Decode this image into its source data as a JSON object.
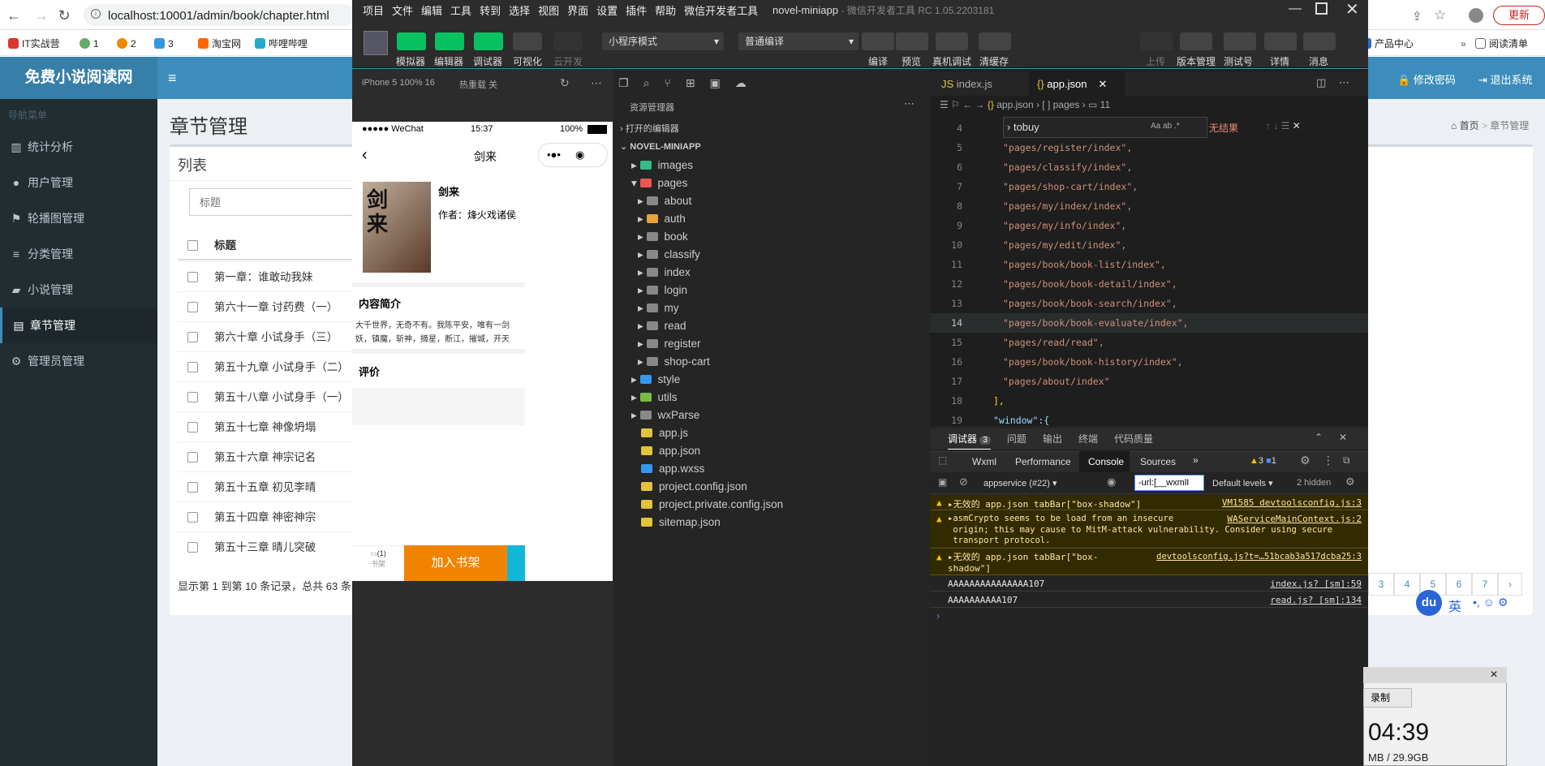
{
  "browser": {
    "url": "localhost:10001/admin/book/chapter.html",
    "update_label": "更新",
    "bookmarks": [
      "IT实战营",
      "1",
      "2",
      "3",
      "淘宝网",
      "哔哩哔哩"
    ],
    "bookmarks_right": [
      "产品中心",
      "阅读清单"
    ]
  },
  "admin": {
    "brand": "免费小说阅读网",
    "change_pwd": "修改密码",
    "logout": "退出系统",
    "nav_header": "导航菜单",
    "menu": [
      {
        "label": "统计分析"
      },
      {
        "label": "用户管理"
      },
      {
        "label": "轮播图管理"
      },
      {
        "label": "分类管理"
      },
      {
        "label": "小说管理"
      },
      {
        "label": "章节管理"
      },
      {
        "label": "管理员管理"
      }
    ],
    "page_title": "章节管理",
    "crumb_home": "首页",
    "crumb_current": "章节管理",
    "box_title": "列表",
    "search_placeholder": "标题",
    "col_title": "标题",
    "rows": [
      "第一章：谁敢动我妹",
      "第六十一章 讨药费（一）",
      "第六十章 小试身手（三）",
      "第五十九章 小试身手（二）",
      "第五十八章 小试身手（一）",
      "第五十七章 神像坍塌",
      "第五十六章 神宗记名",
      "第五十五章 初见李晴",
      "第五十四章 神密神宗",
      "第五十三章 晴儿突破"
    ],
    "footer_text": "显示第 1 到第 10 条记录，总共 63 条",
    "pages": [
      "3",
      "4",
      "5",
      "6",
      "7",
      "›"
    ]
  },
  "devtools": {
    "menu": [
      "项目",
      "文件",
      "编辑",
      "工具",
      "转到",
      "选择",
      "视图",
      "界面",
      "设置",
      "插件",
      "帮助",
      "微信开发者工具"
    ],
    "title": "novel-miniapp",
    "title_suffix": "- 微信开发者工具 RC 1.05.2203181",
    "toolbar": {
      "simulator": "模拟器",
      "editor": "编辑器",
      "debugger": "调试器",
      "visual": "可视化",
      "cloud": "云开发",
      "mode": "小程序模式",
      "compile_mode": "普通编译",
      "compile": "编译",
      "preview": "预览",
      "real_debug": "真机调试",
      "clear_cache": "清缓存",
      "upload": "上传",
      "version": "版本管理",
      "test": "测试号",
      "details": "详情",
      "messages": "消息"
    },
    "device": "iPhone 5 100% 16",
    "hot_reload": "热重载 关",
    "phone": {
      "carrier": "●●●●● WeChat",
      "time": "15:37",
      "battery": "100%",
      "nav_title": "剑来",
      "book_title": "剑来",
      "author": "作者：烽火戏诸侯",
      "intro_h": "内容简介",
      "intro_1": "大千世界，无奇不有。我陈平安，唯有一剑",
      "intro_2": "妖，镇魔，斩神，摘星，断江，摧城，开天",
      "review_h": "评价",
      "shelf": "书架",
      "shelf_badge": "(1)",
      "add_btn": "加入书架"
    },
    "explorer": {
      "header": "资源管理器",
      "open_editors": "打开的编辑器",
      "project": "NOVEL-MINIAPP",
      "folders": [
        "images",
        "pages",
        "about",
        "auth",
        "book",
        "classify",
        "index",
        "login",
        "my",
        "read",
        "register",
        "shop-cart",
        "style",
        "utils",
        "wxParse"
      ],
      "files": [
        "app.js",
        "app.json",
        "app.wxss",
        "project.config.json",
        "project.private.config.json",
        "sitemap.json"
      ]
    },
    "tabs": [
      "index.js",
      "app.json"
    ],
    "breadcrumb": [
      "app.json",
      "[ ] pages",
      "11"
    ],
    "find": {
      "query": "tobuy",
      "result": "无结果"
    },
    "code": [
      {
        "n": "4",
        "t": ""
      },
      {
        "n": "5",
        "t": "\"pages/register/index\","
      },
      {
        "n": "6",
        "t": "\"pages/classify/index\","
      },
      {
        "n": "7",
        "t": "\"pages/shop-cart/index\","
      },
      {
        "n": "8",
        "t": "\"pages/my/index/index\","
      },
      {
        "n": "9",
        "t": "\"pages/my/info/index\","
      },
      {
        "n": "10",
        "t": "\"pages/my/edit/index\","
      },
      {
        "n": "11",
        "t": "\"pages/book/book-list/index\","
      },
      {
        "n": "12",
        "t": "\"pages/book/book-detail/index\","
      },
      {
        "n": "13",
        "t": "\"pages/book/book-search/index\","
      },
      {
        "n": "14",
        "t": "\"pages/book/book-evaluate/index\","
      },
      {
        "n": "15",
        "t": "\"pages/read/read\","
      },
      {
        "n": "16",
        "t": "\"pages/book/book-history/index\","
      },
      {
        "n": "17",
        "t": "\"pages/about/index\""
      },
      {
        "n": "18",
        "t": "],"
      },
      {
        "n": "19",
        "t": "\"window\":{"
      }
    ],
    "panel_tabs": [
      "调试器",
      "问题",
      "输出",
      "终端",
      "代码质量"
    ],
    "panel_badge": "3",
    "console_tabs": [
      "Wxml",
      "Performance",
      "Console",
      "Sources"
    ],
    "warn_count": "3",
    "info_count": "1",
    "context": "appservice (#22)",
    "filter": "-url:[__wxmlI",
    "levels": "Default levels",
    "hidden": "2 hidden",
    "messages": [
      {
        "type": "warn",
        "text": "▸无效的 app.json tabBar[\"box-shadow\"]",
        "src": "VM1585 devtoolsconfig.js:3"
      },
      {
        "type": "warn",
        "text": "▸asmCrypto seems to be load from an insecure\n origin; this may cause to MitM-attack vulnerability. Consider using secure\n transport protocol.",
        "src": "WAServiceMainContext.js:2"
      },
      {
        "type": "warn",
        "text": "▸无效的 app.json tabBar[\"box-\nshadow\"]",
        "src": "devtoolsconfig.js?t=…51bcab3a517dcba25:3"
      },
      {
        "type": "log",
        "text": "AAAAAAAAAAAAAAA107",
        "src": "index.js? [sm]:59"
      },
      {
        "type": "log",
        "text": "AAAAAAAAAA107",
        "src": "read.js? [sm]:134"
      }
    ]
  },
  "floating": {
    "rec": "录制",
    "clock": "04:39",
    "mem": "MB / 29.9GB"
  },
  "ime": {
    "logo": "du",
    "lang": "英"
  }
}
